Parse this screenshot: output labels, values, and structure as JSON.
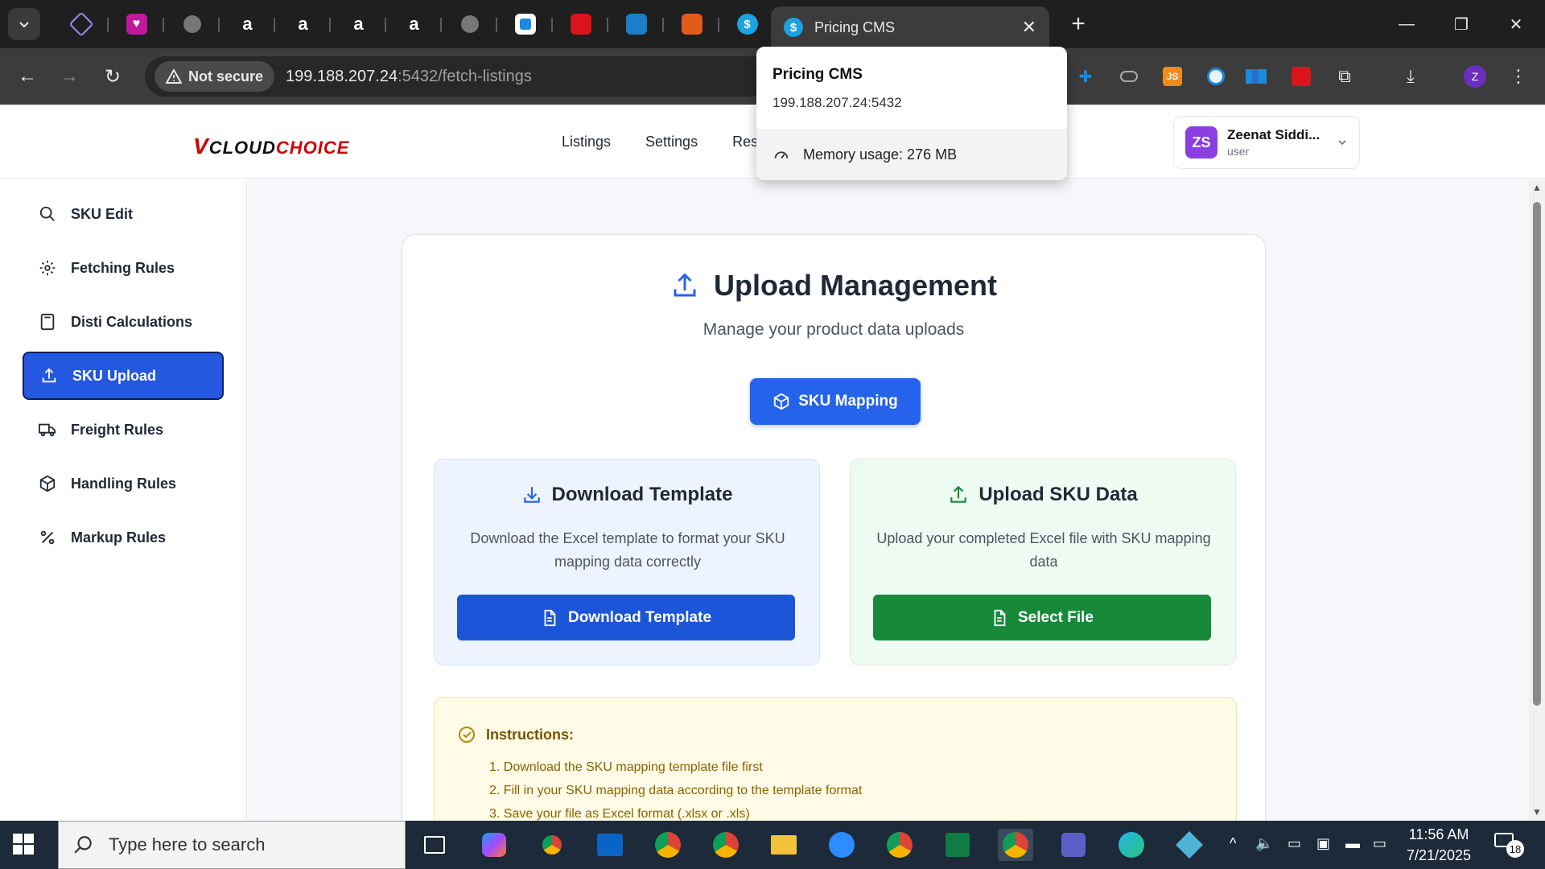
{
  "browser": {
    "active_tab_title": "Pricing CMS",
    "security_label": "Not secure",
    "url_host": "199.188.207.24",
    "url_rest": ":5432/fetch-listings",
    "profile_initial": "Z",
    "hovercard": {
      "title": "Pricing CMS",
      "url": "199.188.207.24:5432",
      "memory": "Memory usage: 276 MB"
    }
  },
  "header": {
    "logo_v": "V",
    "logo_cloud": "CLOUD",
    "logo_choice": "CHOICE",
    "nav": [
      "Listings",
      "Settings",
      "Rese"
    ],
    "user": {
      "initials": "ZS",
      "name": "Zeenat Siddi...",
      "role": "user"
    }
  },
  "sidebar": {
    "items": [
      {
        "label": "SKU Edit",
        "icon": "search-icon"
      },
      {
        "label": "Fetching Rules",
        "icon": "gear-icon"
      },
      {
        "label": "Disti Calculations",
        "icon": "calculator-icon"
      },
      {
        "label": "SKU Upload",
        "icon": "upload-icon",
        "active": true
      },
      {
        "label": "Freight Rules",
        "icon": "truck-icon"
      },
      {
        "label": "Handling Rules",
        "icon": "package-icon"
      },
      {
        "label": "Markup Rules",
        "icon": "percent-icon"
      }
    ]
  },
  "main": {
    "title": "Upload Management",
    "subtitle": "Manage your product data uploads",
    "sku_mapping_label": "SKU Mapping",
    "download": {
      "title": "Download Template",
      "text": "Download the Excel template to format your SKU mapping data correctly",
      "button": "Download Template"
    },
    "upload": {
      "title": "Upload SKU Data",
      "text": "Upload your completed Excel file with SKU mapping data",
      "button": "Select File"
    },
    "instructions": {
      "title": "Instructions:",
      "steps": [
        "1. Download the SKU mapping template file first",
        "2. Fill in your SKU mapping data according to the template format",
        "3. Save your file as Excel format (.xlsx or .xls)"
      ]
    }
  },
  "taskbar": {
    "search_placeholder": "Type here to search",
    "time": "11:56 AM",
    "date": "7/21/2025",
    "notifications": "18"
  },
  "colors": {
    "primary": "#2563eb",
    "success": "#178a3a",
    "sidebar_active": "#2458e0",
    "brand_red": "#cc0000",
    "avatar": "#8b3fe0"
  }
}
